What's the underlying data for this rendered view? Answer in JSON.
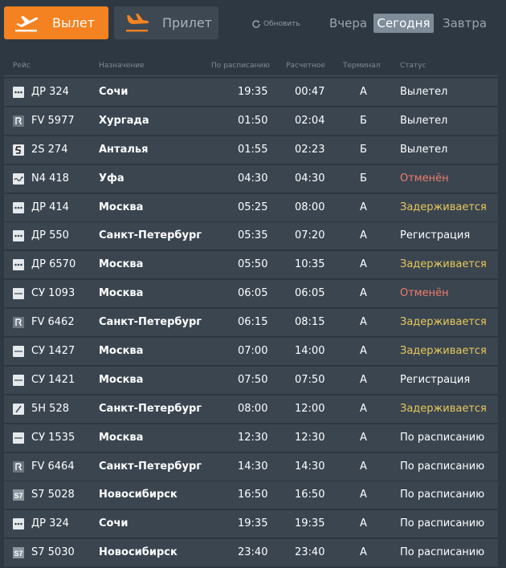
{
  "tabs": {
    "departure": "Вылет",
    "arrival": "Прилет"
  },
  "refresh_label": "Обновить",
  "days": {
    "yesterday": "Вчера",
    "today": "Сегодня",
    "tomorrow": "Завтра",
    "selected": "today"
  },
  "columns": {
    "flight": "Рейс",
    "destination": "Назначение",
    "scheduled": "По расписанию",
    "estimated": "Расчетное",
    "terminal": "Терминал",
    "status": "Статус"
  },
  "colors": {
    "accent": "#f58220",
    "background": "#2e3843",
    "row": "#3a4550",
    "cancelled": "#f07c6b",
    "delayed": "#e8c85a"
  },
  "flights": [
    {
      "logo": "airline-logo-dots",
      "flight": "ДР 324",
      "destination": "Сочи",
      "scheduled": "19:35",
      "estimated": "00:47",
      "terminal": "A",
      "status": "Вылетел",
      "status_type": "departed"
    },
    {
      "logo": "airline-logo-r",
      "flight": "FV 5977",
      "destination": "Хургада",
      "scheduled": "01:50",
      "estimated": "02:04",
      "terminal": "Б",
      "status": "Вылетел",
      "status_type": "departed"
    },
    {
      "logo": "airline-logo-s",
      "flight": "2S 274",
      "destination": "Анталья",
      "scheduled": "01:55",
      "estimated": "02:23",
      "terminal": "Б",
      "status": "Вылетел",
      "status_type": "departed"
    },
    {
      "logo": "airline-logo-wave",
      "flight": "N4 418",
      "destination": "Уфа",
      "scheduled": "04:30",
      "estimated": "04:30",
      "terminal": "Б",
      "status": "Отменён",
      "status_type": "cancelled"
    },
    {
      "logo": "airline-logo-dots",
      "flight": "ДР 414",
      "destination": "Москва",
      "scheduled": "05:25",
      "estimated": "08:00",
      "terminal": "A",
      "status": "Задерживается",
      "status_type": "delayed"
    },
    {
      "logo": "airline-logo-dots",
      "flight": "ДР 550",
      "destination": "Санкт-Петербург",
      "scheduled": "05:35",
      "estimated": "07:20",
      "terminal": "A",
      "status": "Регистрация",
      "status_type": "checkin"
    },
    {
      "logo": "airline-logo-dots",
      "flight": "ДР 6570",
      "destination": "Москва",
      "scheduled": "05:50",
      "estimated": "10:35",
      "terminal": "A",
      "status": "Задерживается",
      "status_type": "delayed"
    },
    {
      "logo": "airline-logo-line",
      "flight": "СУ 1093",
      "destination": "Москва",
      "scheduled": "06:05",
      "estimated": "06:05",
      "terminal": "A",
      "status": "Отменён",
      "status_type": "cancelled"
    },
    {
      "logo": "airline-logo-r",
      "flight": "FV 6462",
      "destination": "Санкт-Петербург",
      "scheduled": "06:15",
      "estimated": "08:15",
      "terminal": "A",
      "status": "Задерживается",
      "status_type": "delayed"
    },
    {
      "logo": "airline-logo-line",
      "flight": "СУ 1427",
      "destination": "Москва",
      "scheduled": "07:00",
      "estimated": "14:00",
      "terminal": "A",
      "status": "Задерживается",
      "status_type": "delayed"
    },
    {
      "logo": "airline-logo-line",
      "flight": "СУ 1421",
      "destination": "Москва",
      "scheduled": "07:50",
      "estimated": "07:50",
      "terminal": "A",
      "status": "Регистрация",
      "status_type": "checkin"
    },
    {
      "logo": "airline-logo-slash",
      "flight": "5H 528",
      "destination": "Санкт-Петербург",
      "scheduled": "08:00",
      "estimated": "12:00",
      "terminal": "A",
      "status": "Задерживается",
      "status_type": "delayed"
    },
    {
      "logo": "airline-logo-line",
      "flight": "СУ 1535",
      "destination": "Москва",
      "scheduled": "12:30",
      "estimated": "12:30",
      "terminal": "A",
      "status": "По расписанию",
      "status_type": "ontime"
    },
    {
      "logo": "airline-logo-r",
      "flight": "FV 6464",
      "destination": "Санкт-Петербург",
      "scheduled": "14:30",
      "estimated": "14:30",
      "terminal": "A",
      "status": "По расписанию",
      "status_type": "ontime"
    },
    {
      "logo": "airline-logo-s7",
      "flight": "S7 5028",
      "destination": "Новосибирск",
      "scheduled": "16:50",
      "estimated": "16:50",
      "terminal": "A",
      "status": "По расписанию",
      "status_type": "ontime"
    },
    {
      "logo": "airline-logo-dots",
      "flight": "ДР 324",
      "destination": "Сочи",
      "scheduled": "19:35",
      "estimated": "19:35",
      "terminal": "A",
      "status": "По расписанию",
      "status_type": "ontime"
    },
    {
      "logo": "airline-logo-s7",
      "flight": "S7 5030",
      "destination": "Новосибирск",
      "scheduled": "23:40",
      "estimated": "23:40",
      "terminal": "A",
      "status": "По расписанию",
      "status_type": "ontime"
    }
  ]
}
